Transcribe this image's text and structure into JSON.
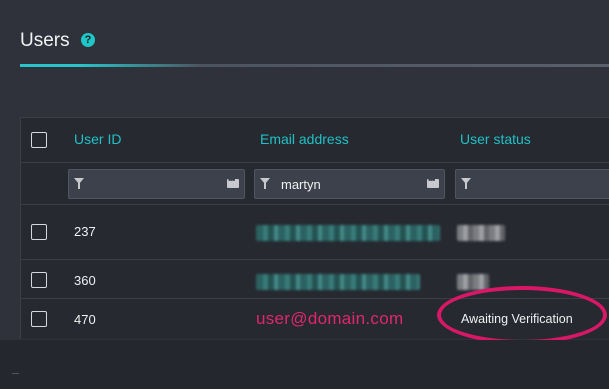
{
  "page": {
    "title": "Users",
    "help_icon": "?"
  },
  "table": {
    "headers": [
      "User ID",
      "Email address",
      "User status"
    ],
    "filters": {
      "user_id": "",
      "email": "martyn",
      "status": ""
    },
    "rows": [
      {
        "id": "237",
        "email": "",
        "status": ""
      },
      {
        "id": "360",
        "email": "",
        "status": ""
      },
      {
        "id": "470",
        "email": "user@domain.com",
        "status": "Awaiting Verification"
      }
    ]
  },
  "colors": {
    "accent": "#1fc1c6",
    "highlight": "#d81766"
  }
}
